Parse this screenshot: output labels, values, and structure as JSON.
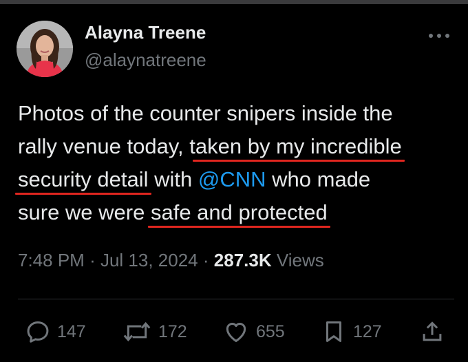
{
  "author": {
    "name": "Alayna Treene",
    "handle": "@alaynatreene",
    "avatar_icon": "profile-photo"
  },
  "tweet": {
    "lines": [
      [
        {
          "text": "Photos of the counter snipers inside the"
        }
      ],
      [
        {
          "text": "rally venue today, t"
        },
        {
          "text": "aken by my incredible",
          "underline": true
        }
      ],
      [
        {
          "text": "security detail",
          "underline": true
        },
        {
          "text": " with "
        },
        {
          "text": "@CNN",
          "mention": true
        },
        {
          "text": " who made"
        }
      ],
      [
        {
          "text": "sure we were "
        },
        {
          "text": "safe and protected",
          "underline": true
        }
      ]
    ]
  },
  "meta": {
    "time": "7:48 PM",
    "separator": "·",
    "date": "Jul 13, 2024",
    "views_count": "287.3K",
    "views_label": "Views"
  },
  "actions": {
    "replies": "147",
    "reposts": "172",
    "likes": "655",
    "bookmarks": "127"
  },
  "colors": {
    "background": "#000000",
    "text": "#e7e9ea",
    "secondary": "#71767b",
    "mention": "#1d9bf0",
    "annotation_underline": "#e0261f"
  }
}
